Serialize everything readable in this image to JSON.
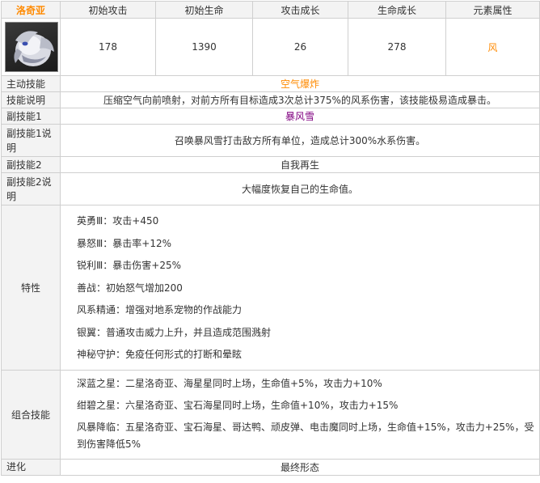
{
  "header": {
    "name": "洛奇亚",
    "columns": [
      "初始攻击",
      "初始生命",
      "攻击成长",
      "生命成长",
      "元素属性"
    ]
  },
  "stats": {
    "attack": "178",
    "hp": "1390",
    "attack_growth": "26",
    "hp_growth": "278",
    "element": "风"
  },
  "colors": {
    "title_orange": "#ff8a00",
    "skill_purple": "#800080",
    "border": "#cfcfcf",
    "label_bg": "#f3f3f3"
  },
  "rows": {
    "active_skill_label": "主动技能",
    "active_skill_value": "空气爆炸",
    "skill_desc_label": "技能说明",
    "skill_desc_value": "压缩空气向前喷射，对前方所有目标造成3次总计375%的风系伤害，该技能极易造成暴击。",
    "sub1_label": "副技能1",
    "sub1_value": "暴风雪",
    "sub1_desc_label": "副技能1说明",
    "sub1_desc_value": "召唤暴风雪打击敌方所有单位，造成总计300%水系伤害。",
    "sub2_label": "副技能2",
    "sub2_value": "自我再生",
    "sub2_desc_label": "副技能2说明",
    "sub2_desc_value": "大幅度恢复自己的生命值。",
    "traits_label": "特性",
    "combo_label": "组合技能",
    "evolution_label": "进化",
    "evolution_value": "最终形态"
  },
  "traits": [
    "英勇Ⅲ：攻击+450",
    "暴怒Ⅲ：暴击率+12%",
    "锐利Ⅲ：暴击伤害+25%",
    "善战：初始怒气增加200",
    "风系精通：增强对地系宠物的作战能力",
    "银翼：普通攻击威力上升，并且造成范围溅射",
    "神秘守护：免疫任何形式的打断和晕眩"
  ],
  "combos": [
    "深蓝之星：二星洛奇亚、海星星同时上场，生命值+5%，攻击力+10%",
    "绀碧之星：六星洛奇亚、宝石海星同时上场，生命值+10%，攻击力+15%",
    "风暴降临：五星洛奇亚、宝石海星、哥达鸭、顽皮弹、电击魔同时上场，生命值+15%，攻击力+25%，受到伤害降低5%"
  ]
}
